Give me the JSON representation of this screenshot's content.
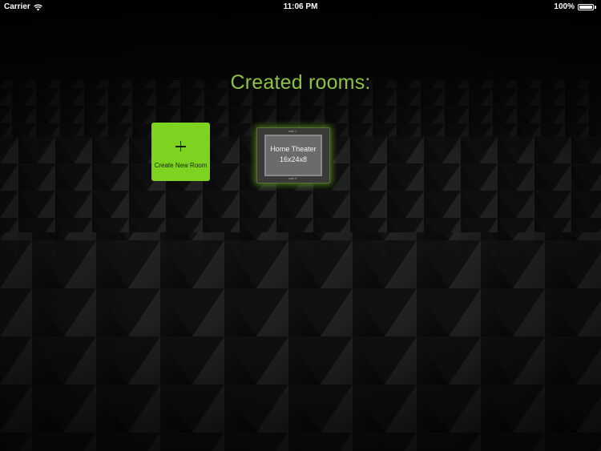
{
  "status_bar": {
    "carrier": "Carrier",
    "time": "11:06 PM",
    "battery_percent": "100%",
    "battery_level": 1.0,
    "wifi_icon": "wifi-icon",
    "battery_icon": "battery-icon"
  },
  "title": "Created rooms:",
  "create_tile": {
    "icon": "plus-icon",
    "label": "Create New Room",
    "color": "#7ed321"
  },
  "rooms": [
    {
      "name": "Home Theater",
      "dimensions": "16x24x8"
    }
  ],
  "colors": {
    "accent": "#8bc53f",
    "background": "#141414"
  }
}
